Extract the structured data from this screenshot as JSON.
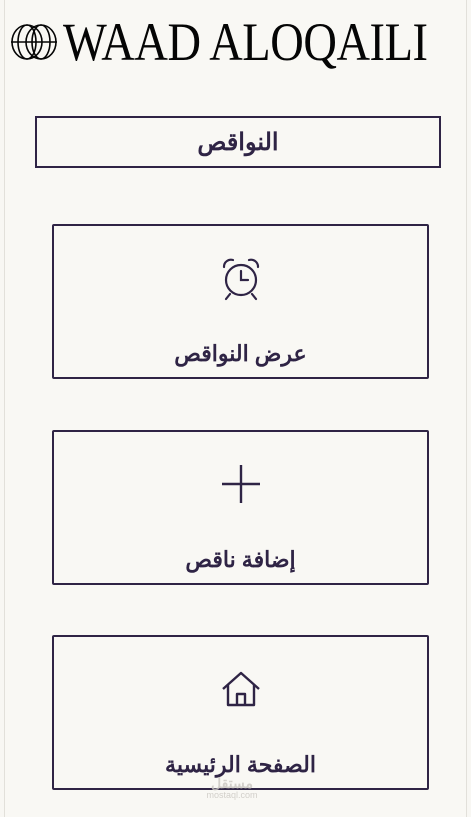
{
  "brand": {
    "name": "WAAD ALOQAILI",
    "logo_icon": "interlocking-rings-icon"
  },
  "page": {
    "title": "النواقص"
  },
  "cards": [
    {
      "label": "عرض النواقص",
      "icon": "alarm-clock-icon"
    },
    {
      "label": "إضافة ناقص",
      "icon": "plus-icon"
    },
    {
      "label": "الصفحة الرئيسية",
      "icon": "home-icon"
    }
  ],
  "watermark": {
    "arabic": "مستقل",
    "latin": "mostaql.com"
  },
  "colors": {
    "background": "#f9f8f4",
    "primary": "#2f2445",
    "brand_text": "#050505"
  }
}
